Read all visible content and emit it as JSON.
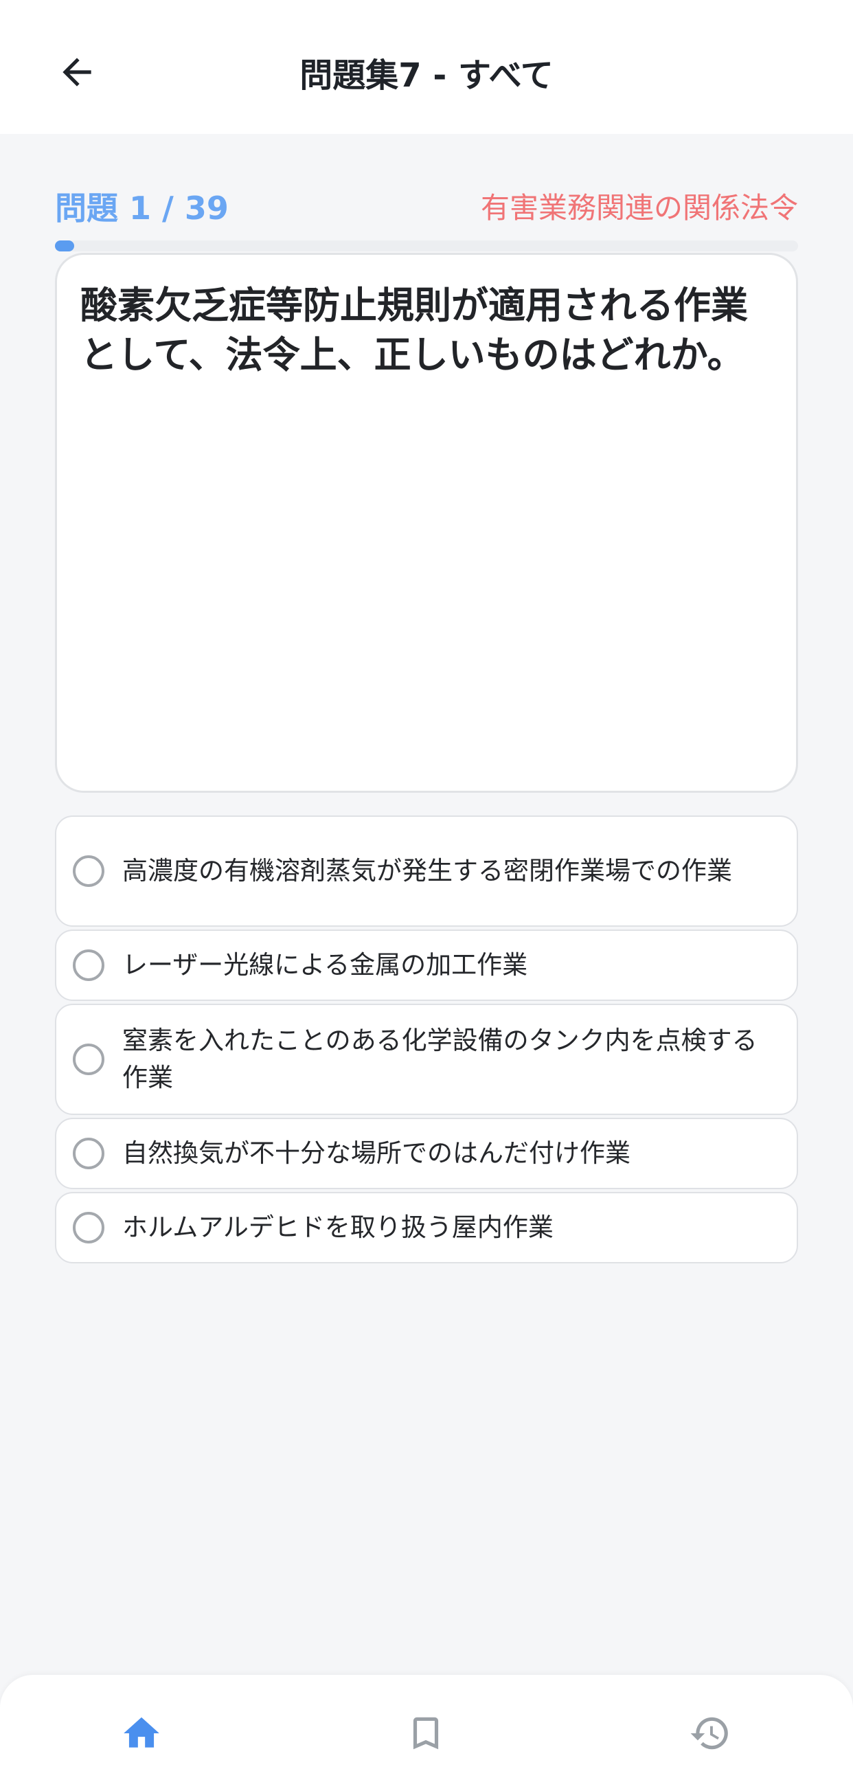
{
  "header": {
    "title": "問題集7 - すべて",
    "back_icon": "arrow-left-icon"
  },
  "progress": {
    "counter_label": "問題 1 / 39",
    "current": 1,
    "total": 39,
    "fraction": 0.026,
    "category": "有害業務関連の関係法令"
  },
  "question": {
    "text": "酸素欠乏症等防止規則が適用される作業として、法令上、正しいものはどれか。"
  },
  "options": [
    {
      "label": "高濃度の有機溶剤蒸気が発生する密閉作業場での作業"
    },
    {
      "label": "レーザー光線による金属の加工作業"
    },
    {
      "label": "窒素を入れたことのある化学設備のタンク内を点検する作業"
    },
    {
      "label": "自然換気が不十分な場所でのはんだ付け作業"
    },
    {
      "label": "ホルムアルデヒドを取り扱う屋内作業"
    }
  ],
  "bottom_nav": {
    "items": [
      {
        "icon": "home-icon",
        "active": true
      },
      {
        "icon": "bookmark-icon",
        "active": false
      },
      {
        "icon": "history-icon",
        "active": false
      }
    ]
  },
  "colors": {
    "accent": "#5b9cf0",
    "counter": "#6aa6f3",
    "category": "#f07476",
    "inactive_icon": "#9aa0a6"
  }
}
